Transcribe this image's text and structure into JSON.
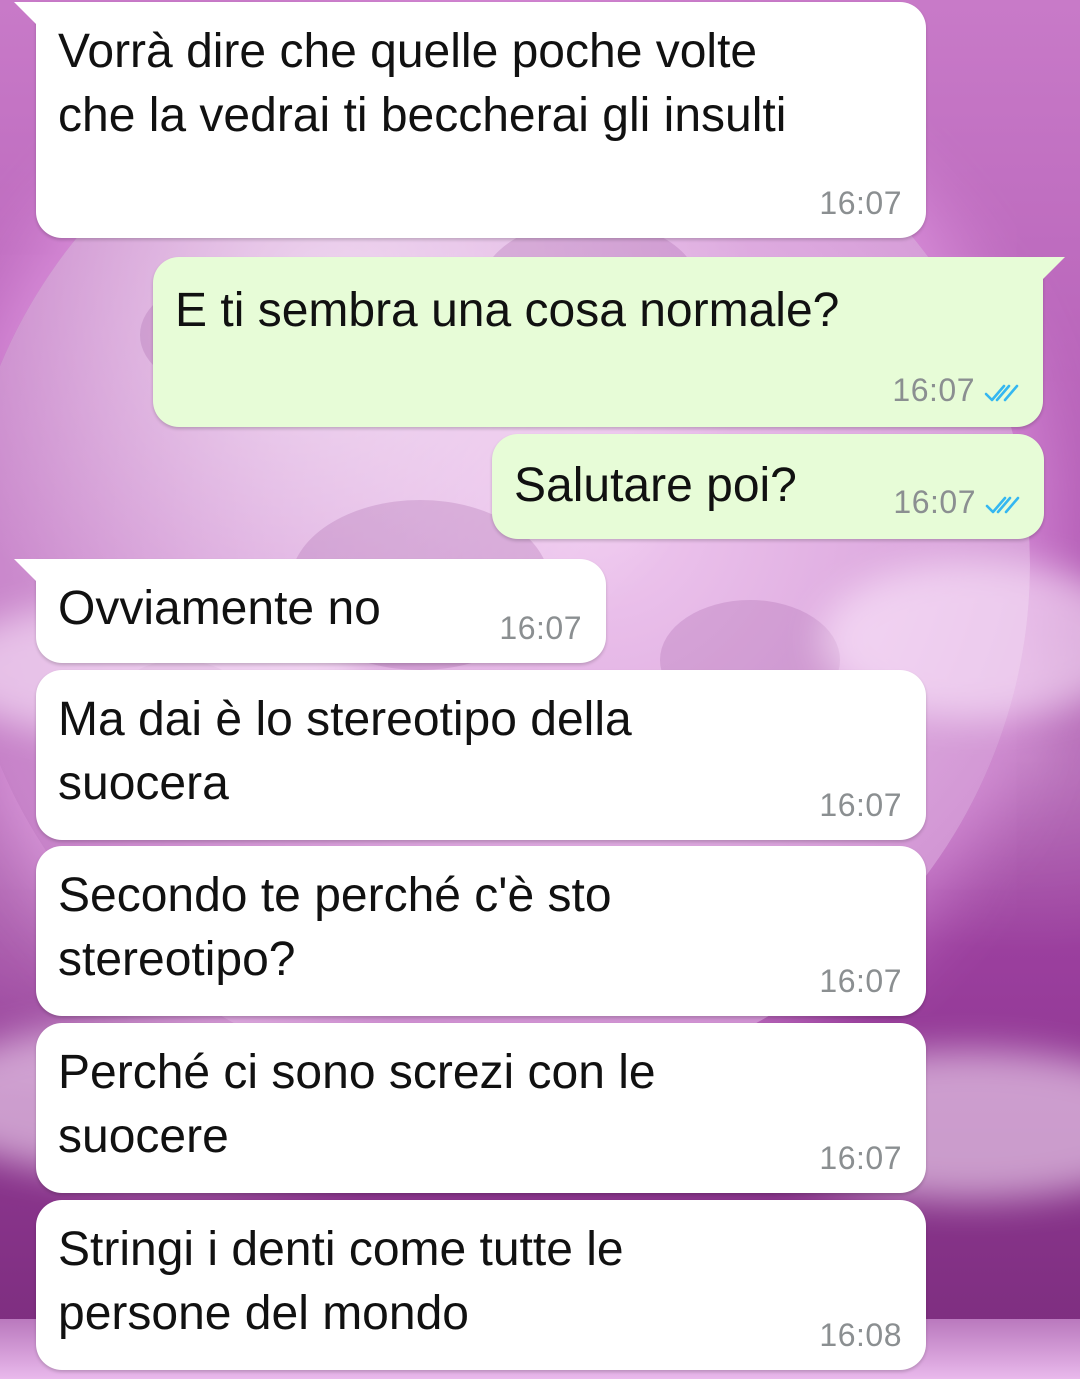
{
  "chat": {
    "messages": [
      {
        "direction": "incoming",
        "text": "Vorrà dire che quelle poche volte\nche la vedrai ti beccherai gli insulti",
        "time": "16:07"
      },
      {
        "direction": "outgoing",
        "text": "E ti sembra una cosa normale?",
        "time": "16:07",
        "status_icon": "double-check-read-icon"
      },
      {
        "direction": "outgoing",
        "text": "Salutare poi?",
        "time": "16:07",
        "status_icon": "double-check-read-icon"
      },
      {
        "direction": "incoming",
        "text": "Ovviamente no",
        "time": "16:07"
      },
      {
        "direction": "incoming",
        "text": "Ma dai è lo stereotipo della\nsuocera",
        "time": "16:07"
      },
      {
        "direction": "incoming",
        "text": "Secondo te perché c'è sto\nstereotipo?",
        "time": "16:07"
      },
      {
        "direction": "incoming",
        "text": "Perché ci sono screzi con le\nsuocere",
        "time": "16:07"
      },
      {
        "direction": "incoming",
        "text": "Stringi i denti come tutte le\npersone del mondo",
        "time": "16:08"
      }
    ]
  },
  "colors": {
    "incoming_bubble": "#ffffff",
    "outgoing_bubble": "#e7fcd7",
    "read_ticks": "#34b7f1",
    "timestamp": "#8b8f91",
    "wallpaper": "#b25bb4"
  }
}
